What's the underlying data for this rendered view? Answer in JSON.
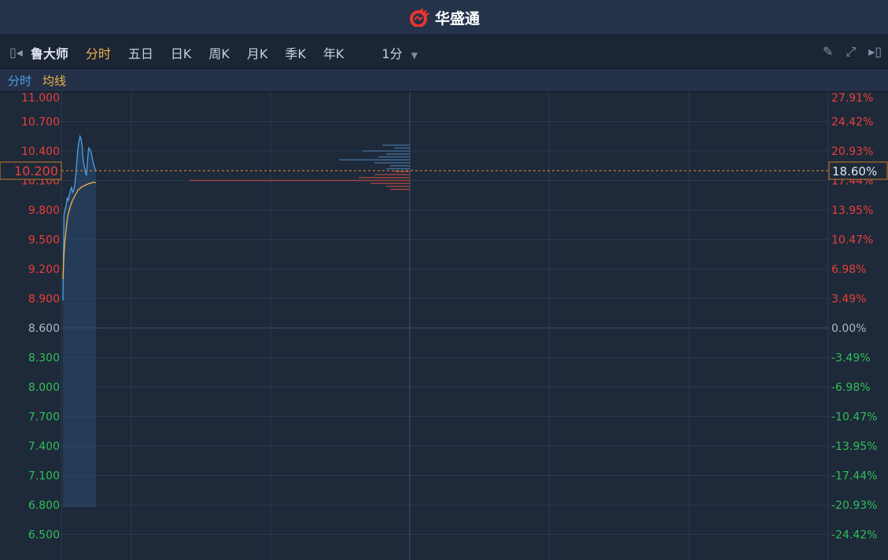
{
  "app": {
    "title": "华盛通",
    "accent": "#e8352f"
  },
  "toolbar": {
    "stock_name": "鲁大师",
    "tabs": [
      "分时",
      "五日",
      "日K",
      "周K",
      "月K",
      "季K",
      "年K"
    ],
    "active_tab": "分时",
    "interval": "1分"
  },
  "legend": {
    "price": "分时",
    "avg": "均线",
    "price_color": "#4aa3e8",
    "avg_color": "#f0b24a"
  },
  "chart_data": {
    "type": "line",
    "prev_close": 8.6,
    "current_price": "10.200",
    "current_change": "18.60%",
    "ylim": [
      6.35,
      11.09
    ],
    "y_ticks": [
      "11.000",
      "10.700",
      "10.400",
      "10.100",
      "9.800",
      "9.500",
      "9.200",
      "8.900",
      "8.600",
      "8.300",
      "8.000",
      "7.700",
      "7.400",
      "7.100",
      "6.800",
      "6.500"
    ],
    "pct_ticks": [
      "27.91%",
      "24.42%",
      "20.93%",
      "17.44%",
      "13.95%",
      "10.47%",
      "6.98%",
      "3.49%",
      "0.00%",
      "-3.49%",
      "-6.98%",
      "-10.47%",
      "-13.95%",
      "-17.44%",
      "-20.93%",
      "-24.42%"
    ],
    "total_minutes": 331,
    "series": [
      {
        "name": "分时",
        "values": [
          8.88,
          9.75,
          9.8,
          9.85,
          9.92,
          9.9,
          9.95,
          10.0,
          10.03,
          9.98,
          10.0,
          10.05,
          10.15,
          10.3,
          10.42,
          10.5,
          10.55,
          10.52,
          10.45,
          10.3,
          10.25,
          10.18,
          10.15,
          10.3,
          10.43,
          10.42,
          10.4,
          10.35,
          10.3,
          10.25,
          10.22,
          10.2
        ]
      },
      {
        "name": "均线",
        "values": [
          9.1,
          9.35,
          9.5,
          9.6,
          9.7,
          9.76,
          9.8,
          9.84,
          9.87,
          9.9,
          9.92,
          9.94,
          9.96,
          9.98,
          10.0,
          10.01,
          10.02,
          10.03,
          10.04,
          10.04,
          10.05,
          10.05,
          10.06,
          10.06,
          10.07,
          10.07,
          10.07,
          10.08,
          10.08,
          10.08,
          10.08,
          10.08
        ]
      }
    ],
    "volume_profile": [
      {
        "price": 10.46,
        "vol": 0.35
      },
      {
        "price": 10.43,
        "vol": 0.2
      },
      {
        "price": 10.4,
        "vol": 0.6
      },
      {
        "price": 10.37,
        "vol": 0.3
      },
      {
        "price": 10.34,
        "vol": 0.4
      },
      {
        "price": 10.31,
        "vol": 0.9
      },
      {
        "price": 10.28,
        "vol": 0.45
      },
      {
        "price": 10.25,
        "vol": 0.25
      },
      {
        "price": 10.22,
        "vol": 0.3
      },
      {
        "price": 10.19,
        "vol": 0.2
      },
      {
        "price": 10.16,
        "vol": 0.45
      },
      {
        "price": 10.13,
        "vol": 0.65
      },
      {
        "price": 10.1,
        "vol": 2.8
      },
      {
        "price": 10.07,
        "vol": 0.5
      },
      {
        "price": 10.04,
        "vol": 0.3
      },
      {
        "price": 10.01,
        "vol": 0.25
      }
    ]
  }
}
